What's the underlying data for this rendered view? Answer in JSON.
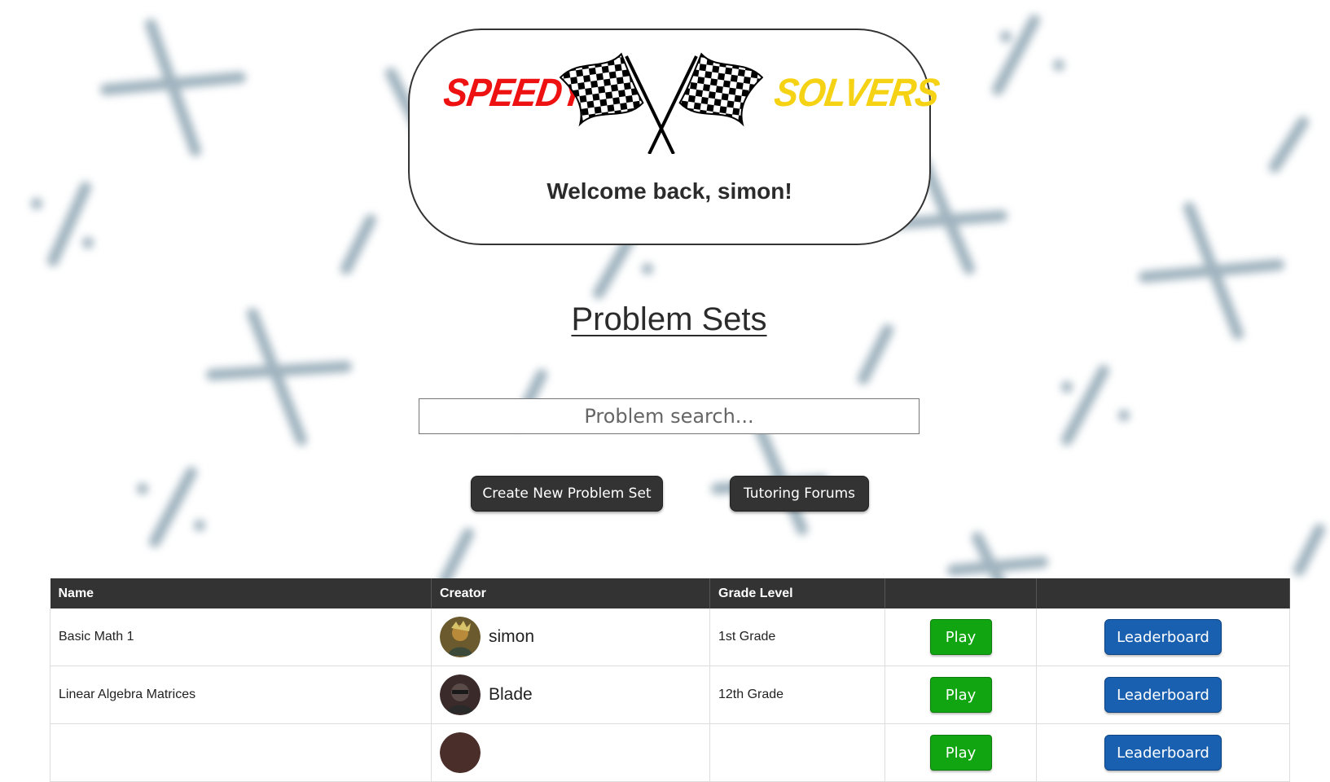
{
  "header": {
    "logo_left": "SPEEDY",
    "logo_right": "SOLVERS",
    "welcome": "Welcome back, simon!"
  },
  "page_title": "Problem Sets",
  "search": {
    "placeholder": "Problem search...",
    "value": ""
  },
  "actions": {
    "create_label": "Create New Problem Set",
    "forums_label": "Tutoring Forums"
  },
  "table": {
    "headers": [
      "Name",
      "Creator",
      "Grade Level",
      "",
      ""
    ],
    "rows": [
      {
        "name": "Basic Math 1",
        "creator": "simon",
        "grade": "1st Grade",
        "play": "Play",
        "leaderboard": "Leaderboard"
      },
      {
        "name": "Linear Algebra Matrices",
        "creator": "Blade",
        "grade": "12th Grade",
        "play": "Play",
        "leaderboard": "Leaderboard"
      },
      {
        "name": "",
        "creator": "",
        "grade": "",
        "play": "Play",
        "leaderboard": "Leaderboard"
      }
    ]
  },
  "colors": {
    "logo_left": "#ee1111",
    "logo_right": "#f5d314",
    "dark": "#333333",
    "play": "#11a611",
    "leaderboard": "#1960b0",
    "bg_symbols": "#8fa6b3"
  },
  "icons": {
    "logo": "checkered-flags-icon",
    "background": [
      "times-symbol-icon",
      "percent-symbol-icon",
      "divide-slash-icon"
    ]
  }
}
